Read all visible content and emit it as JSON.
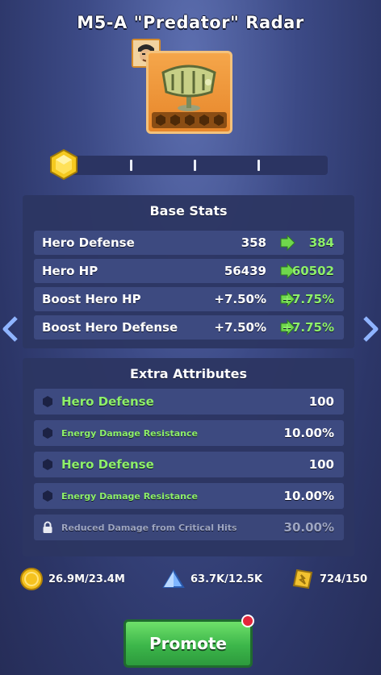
{
  "item": {
    "title": "M5-A \"Predator\" Radar",
    "accent_color": "#f5a64a"
  },
  "base_stats": {
    "heading": "Base Stats",
    "rows": [
      {
        "name": "Hero Defense",
        "current": "358",
        "next": "384"
      },
      {
        "name": "Hero HP",
        "current": "56439",
        "next": "60502"
      },
      {
        "name": "Boost Hero HP",
        "current": "+7.50%",
        "next": "+7.75%"
      },
      {
        "name": "Boost Hero Defense",
        "current": "+7.50%",
        "next": "+7.75%"
      }
    ]
  },
  "extra_attributes": {
    "heading": "Extra Attributes",
    "rows": [
      {
        "name": "Hero Defense",
        "value": "100",
        "locked": false
      },
      {
        "name": "Energy Damage Resistance",
        "value": "10.00%",
        "locked": false
      },
      {
        "name": "Hero Defense",
        "value": "100",
        "locked": false
      },
      {
        "name": "Energy Damage Resistance",
        "value": "10.00%",
        "locked": false
      },
      {
        "name": "Reduced Damage from Critical Hits",
        "value": "30.00%",
        "locked": true
      }
    ]
  },
  "resources": {
    "coins": "26.9M/23.4M",
    "crystals": "63.7K/12.5K",
    "scrolls": "724/150"
  },
  "actions": {
    "promote_label": "Promote"
  },
  "colors": {
    "upgrade_green": "#8ef06a",
    "button_green": "#3cb64a",
    "notification_red": "#e3263a"
  }
}
